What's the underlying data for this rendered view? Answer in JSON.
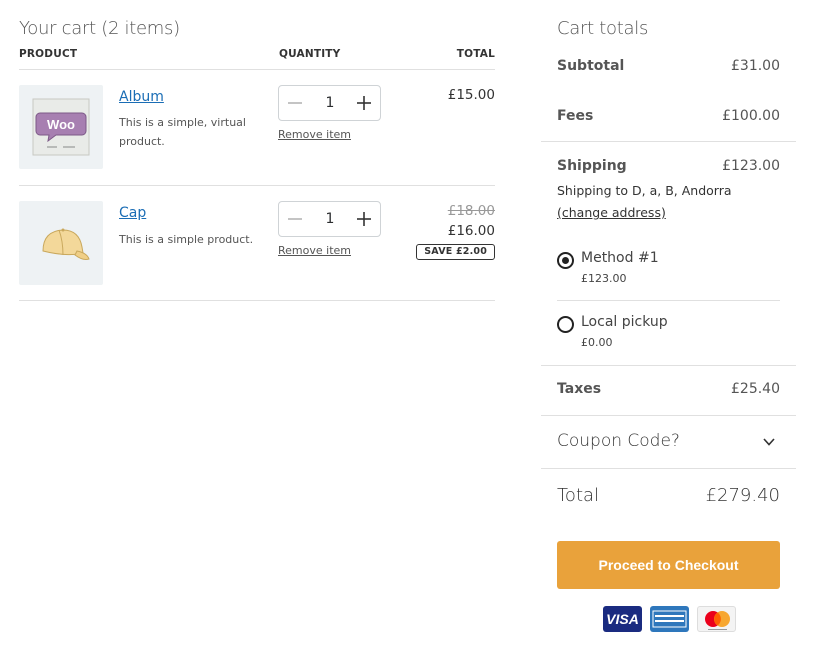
{
  "cart": {
    "title": "Your cart (2 items)",
    "columns": {
      "product": "PRODUCT",
      "quantity": "QUANTITY",
      "total": "TOTAL"
    },
    "items": [
      {
        "name": "Album",
        "description": "This is a simple, virtual product.",
        "quantity": "1",
        "remove_label": "Remove item",
        "price": "£15.00"
      },
      {
        "name": "Cap",
        "description": "This is a simple product.",
        "quantity": "1",
        "remove_label": "Remove item",
        "old_price": "£18.00",
        "price": "£16.00",
        "save_badge": "SAVE £2.00"
      }
    ]
  },
  "totals": {
    "title": "Cart totals",
    "subtotal_label": "Subtotal",
    "subtotal_value": "£31.00",
    "fees_label": "Fees",
    "fees_value": "£100.00",
    "shipping_label": "Shipping",
    "shipping_value": "£123.00",
    "shipping_to": "Shipping to D, a, B, Andorra",
    "change_address": "(change address)",
    "shipping_options": [
      {
        "label": "Method #1",
        "price": "£123.00",
        "selected": true
      },
      {
        "label": "Local pickup",
        "price": "£0.00",
        "selected": false
      }
    ],
    "taxes_label": "Taxes",
    "taxes_value": "£25.40",
    "coupon_label": "Coupon Code?",
    "total_label": "Total",
    "total_value": "£279.40",
    "checkout_label": "Proceed to Checkout",
    "card_visa": "VISA"
  },
  "colors": {
    "accent": "#e9a23b",
    "link": "#1a6db5"
  }
}
